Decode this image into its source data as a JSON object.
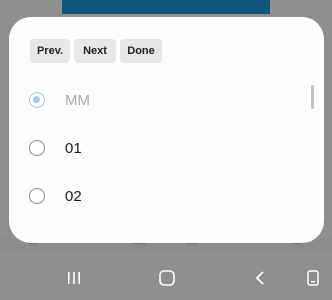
{
  "toolbar": {
    "prev_label": "Prev.",
    "next_label": "Next",
    "done_label": "Done"
  },
  "options": [
    {
      "label": "MM",
      "selected": true
    },
    {
      "label": "01",
      "selected": false
    },
    {
      "label": "02",
      "selected": false
    }
  ],
  "colors": {
    "accent_radio": "#9ecbf0",
    "backdrop": "#8f8f8f",
    "banner": "#0d5878",
    "dialog_bg": "#fdfdfd"
  },
  "nav_icons": [
    "recent-apps-icon",
    "home-icon",
    "back-icon",
    "keyboard-icon"
  ]
}
